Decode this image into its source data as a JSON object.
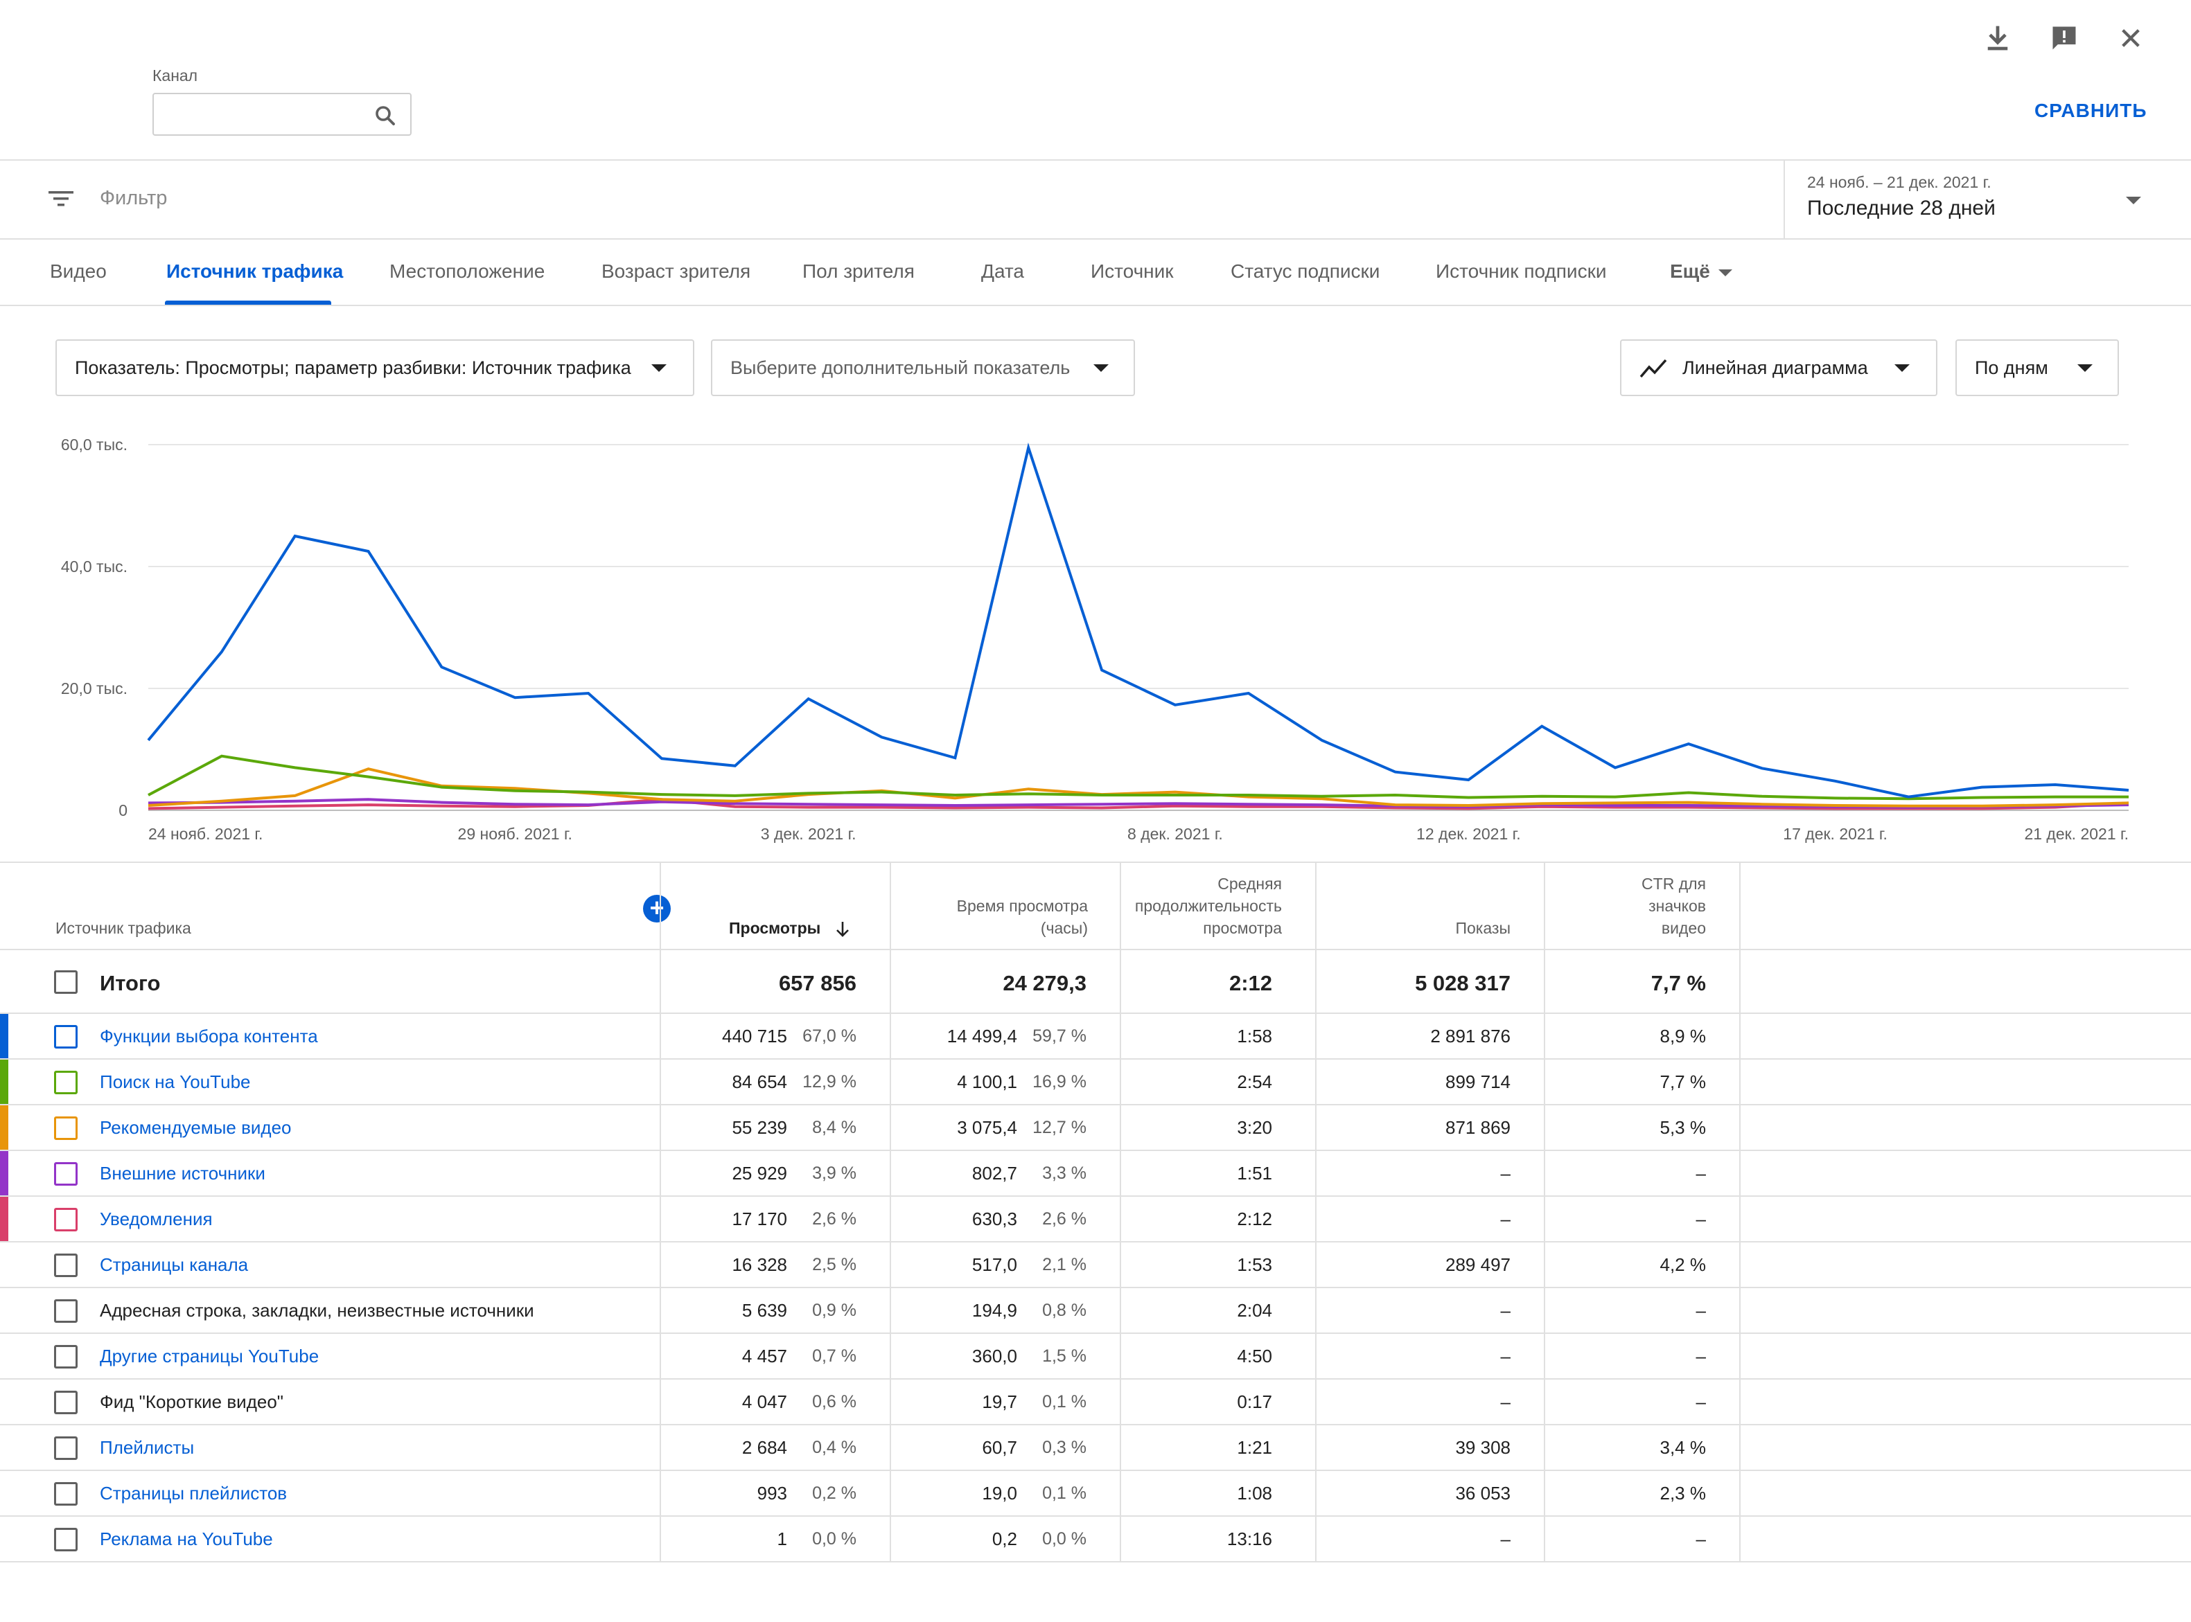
{
  "header": {
    "channel_label": "Канал",
    "channel_input_value": "",
    "compare_label": "СРАВНИТЬ"
  },
  "filter": {
    "placeholder": "Фильтр",
    "date_range": "24 нояб. – 21 дек. 2021 г.",
    "date_preset": "Последние 28 дней"
  },
  "tabs": [
    {
      "label": "Видео",
      "active": false
    },
    {
      "label": "Источник трафика",
      "active": true
    },
    {
      "label": "Местоположение",
      "active": false
    },
    {
      "label": "Возраст зрителя",
      "active": false
    },
    {
      "label": "Пол зрителя",
      "active": false
    },
    {
      "label": "Дата",
      "active": false
    },
    {
      "label": "Источник",
      "active": false
    },
    {
      "label": "Статус подписки",
      "active": false
    },
    {
      "label": "Источник подписки",
      "active": false
    },
    {
      "label": "Ещё",
      "active": false
    }
  ],
  "controls": {
    "metric_dropdown": "Показатель: Просмотры; параметр разбивки: Источник трафика",
    "secondary_metric": "Выберите дополнительный показатель",
    "chart_type": "Линейная диаграмма",
    "granularity": "По дням"
  },
  "chart_data": {
    "type": "line",
    "y_ticks": [
      "0",
      "20,0 тыс.",
      "40,0 тыс.",
      "60,0 тыс."
    ],
    "ylim": [
      0,
      60000
    ],
    "x_tick_labels": [
      "24 нояб. 2021 г.",
      "29 нояб. 2021 г.",
      "3 дек. 2021 г.",
      "8 дек. 2021 г.",
      "12 дек. 2021 г.",
      "17 дек. 2021 г.",
      "21 дек. 2021 г."
    ],
    "x_tick_indices": [
      0,
      5,
      9,
      14,
      18,
      23,
      27
    ],
    "days": 28,
    "grid": true,
    "series": [
      {
        "name": "Функции выбора контента",
        "color": "#065fd4",
        "values": [
          11500,
          26000,
          45000,
          42500,
          23500,
          18500,
          19200,
          8500,
          7300,
          18300,
          12000,
          8600,
          59500,
          23000,
          17300,
          19200,
          11500,
          6300,
          5000,
          13800,
          7000,
          10900,
          6900,
          4800,
          2200,
          3800,
          4200,
          3300
        ]
      },
      {
        "name": "Поиск на YouTube",
        "color": "#5ba80a",
        "values": [
          2500,
          8900,
          7000,
          5500,
          3800,
          3200,
          3000,
          2600,
          2400,
          2800,
          3000,
          2500,
          2700,
          2500,
          2500,
          2500,
          2300,
          2500,
          2100,
          2300,
          2200,
          2900,
          2300,
          2000,
          1900,
          2100,
          2200,
          2200
        ]
      },
      {
        "name": "Рекомендуемые видео",
        "color": "#e8950a",
        "values": [
          800,
          1500,
          2400,
          6800,
          4000,
          3600,
          2800,
          1800,
          1500,
          2600,
          3200,
          2000,
          3500,
          2600,
          3000,
          2200,
          1900,
          900,
          800,
          1100,
          1200,
          1300,
          1000,
          800,
          700,
          700,
          900,
          1200
        ]
      },
      {
        "name": "Внешние источники",
        "color": "#9334c8",
        "values": [
          1200,
          1300,
          1500,
          1800,
          1300,
          1000,
          900,
          1400,
          1100,
          1000,
          900,
          800,
          900,
          1000,
          1100,
          1000,
          900,
          700,
          600,
          900,
          800,
          800,
          700,
          600,
          500,
          600,
          700,
          900
        ]
      },
      {
        "name": "Уведомления",
        "color": "#d93f6a",
        "values": [
          300,
          500,
          700,
          900,
          700,
          600,
          800,
          1800,
          600,
          500,
          500,
          400,
          500,
          400,
          700,
          600,
          600,
          400,
          300,
          600,
          500,
          500,
          400,
          300,
          300,
          300,
          500,
          1200
        ]
      }
    ]
  },
  "table": {
    "headers": {
      "source": "Источник трафика",
      "views": "Просмотры",
      "watch_time_1": "Время просмотра",
      "watch_time_2": "(часы)",
      "avg_dur_1": "Средняя",
      "avg_dur_2": "продолжительность",
      "avg_dur_3": "просмотра",
      "impressions": "Показы",
      "ctr_1": "CTR для",
      "ctr_2": "значков",
      "ctr_3": "видео"
    },
    "total": {
      "name": "Итого",
      "views": "657 856",
      "watch": "24 279,3",
      "avg": "2:12",
      "impr": "5 028 317",
      "ctr": "7,7 %"
    },
    "rows": [
      {
        "name": "Функции выбора контента",
        "link": true,
        "color": "#065fd4",
        "views": "440 715",
        "views_pct": "67,0 %",
        "watch": "14 499,4",
        "watch_pct": "59,7 %",
        "avg": "1:58",
        "impr": "2 891 876",
        "ctr": "8,9 %"
      },
      {
        "name": "Поиск на YouTube",
        "link": true,
        "color": "#5ba80a",
        "views": "84 654",
        "views_pct": "12,9 %",
        "watch": "4 100,1",
        "watch_pct": "16,9 %",
        "avg": "2:54",
        "impr": "899 714",
        "ctr": "7,7 %"
      },
      {
        "name": "Рекомендуемые видео",
        "link": true,
        "color": "#e8950a",
        "views": "55 239",
        "views_pct": "8,4 %",
        "watch": "3 075,4",
        "watch_pct": "12,7 %",
        "avg": "3:20",
        "impr": "871 869",
        "ctr": "5,3 %"
      },
      {
        "name": "Внешние источники",
        "link": true,
        "color": "#9334c8",
        "views": "25 929",
        "views_pct": "3,9 %",
        "watch": "802,7",
        "watch_pct": "3,3 %",
        "avg": "1:51",
        "impr": "–",
        "ctr": "–"
      },
      {
        "name": "Уведомления",
        "link": true,
        "color": "#d93f6a",
        "views": "17 170",
        "views_pct": "2,6 %",
        "watch": "630,3",
        "watch_pct": "2,6 %",
        "avg": "2:12",
        "impr": "–",
        "ctr": "–"
      },
      {
        "name": "Страницы канала",
        "link": true,
        "color": "",
        "views": "16 328",
        "views_pct": "2,5 %",
        "watch": "517,0",
        "watch_pct": "2,1 %",
        "avg": "1:53",
        "impr": "289 497",
        "ctr": "4,2 %"
      },
      {
        "name": "Адресная строка, закладки, неизвестные источники",
        "link": false,
        "color": "",
        "views": "5 639",
        "views_pct": "0,9 %",
        "watch": "194,9",
        "watch_pct": "0,8 %",
        "avg": "2:04",
        "impr": "–",
        "ctr": "–"
      },
      {
        "name": "Другие страницы YouTube",
        "link": true,
        "color": "",
        "views": "4 457",
        "views_pct": "0,7 %",
        "watch": "360,0",
        "watch_pct": "1,5 %",
        "avg": "4:50",
        "impr": "–",
        "ctr": "–"
      },
      {
        "name": "Фид \"Короткие видео\"",
        "link": false,
        "color": "",
        "views": "4 047",
        "views_pct": "0,6 %",
        "watch": "19,7",
        "watch_pct": "0,1 %",
        "avg": "0:17",
        "impr": "–",
        "ctr": "–"
      },
      {
        "name": "Плейлисты",
        "link": true,
        "color": "",
        "views": "2 684",
        "views_pct": "0,4 %",
        "watch": "60,7",
        "watch_pct": "0,3 %",
        "avg": "1:21",
        "impr": "39 308",
        "ctr": "3,4 %"
      },
      {
        "name": "Страницы плейлистов",
        "link": true,
        "color": "",
        "views": "993",
        "views_pct": "0,2 %",
        "watch": "19,0",
        "watch_pct": "0,1 %",
        "avg": "1:08",
        "impr": "36 053",
        "ctr": "2,3 %"
      },
      {
        "name": "Реклама на YouTube",
        "link": true,
        "color": "",
        "views": "1",
        "views_pct": "0,0 %",
        "watch": "0,2",
        "watch_pct": "0,0 %",
        "avg": "13:16",
        "impr": "–",
        "ctr": "–"
      }
    ]
  }
}
